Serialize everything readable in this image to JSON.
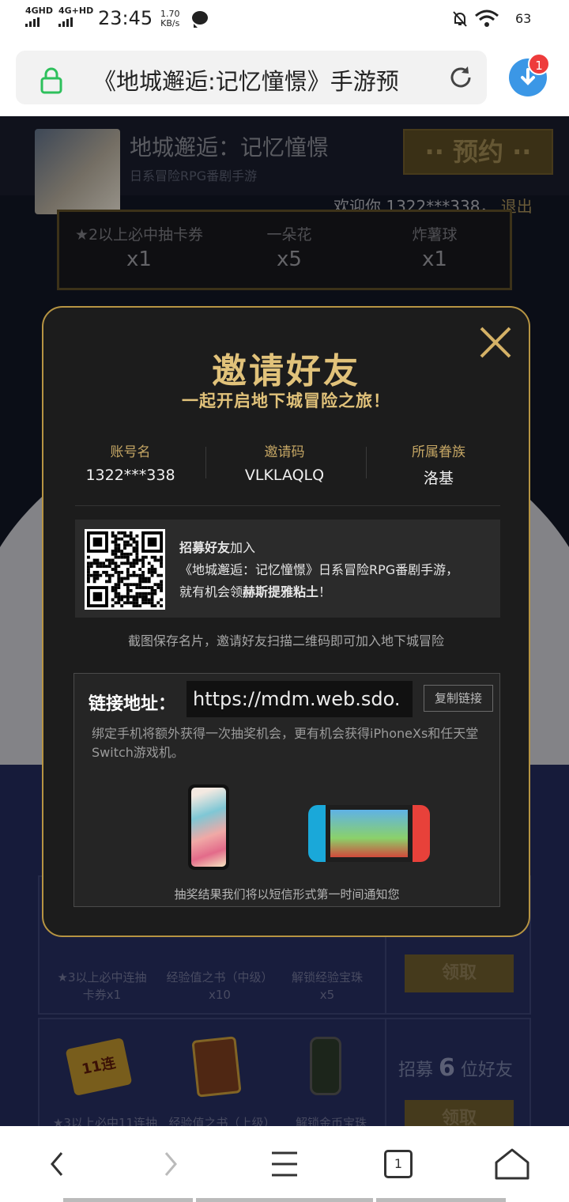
{
  "status_bar": {
    "sim1": "4GHD",
    "sim2": "4G+HD",
    "time": "23:45",
    "speed_value": "1.70",
    "speed_unit": "KB/s",
    "battery": "63"
  },
  "browser": {
    "url_title": "《地城邂逅:记忆憧憬》手游预",
    "download_badge": "1"
  },
  "page": {
    "game_name": "地城邂逅：记忆憧憬",
    "game_subtitle": "日系冒险RPG番剧手游",
    "reserve_label": "·· 预约 ··",
    "welcome_prefix": "欢迎你",
    "welcome_user": "1322***338，",
    "logout_label": "退出",
    "rewards": [
      {
        "name": "★2以上必中抽卡券",
        "qty": "x1"
      },
      {
        "name": "一朵花",
        "qty": "x5"
      },
      {
        "name": "炸薯球",
        "qty": "x1"
      }
    ],
    "task1": {
      "items": [
        {
          "name": "★3以上必中连抽卡券x1",
          "line1": "★3以上必中连抽",
          "line2": "卡券x1"
        },
        {
          "name": "经验值之书（中级）",
          "line1": "经验值之书（中级）",
          "line2": "x10"
        },
        {
          "name": "解锁经验宝珠",
          "line1": "解锁经验宝珠",
          "line2": "x5"
        }
      ],
      "claim_label": "领取"
    },
    "task2": {
      "items": [
        {
          "name": "★3以上必中11连抽",
          "icon_text": "11连"
        },
        {
          "name": "经验值之书（上级）"
        },
        {
          "name": "解锁金币宝珠"
        }
      ],
      "recruit_prefix": "招募",
      "recruit_count": "6",
      "recruit_suffix": "位好友",
      "claim_label": "领取"
    }
  },
  "modal": {
    "title": "邀请好友",
    "subtitle": "一起开启地下城冒险之旅！",
    "account_label": "账号名",
    "account_value": "1322***338",
    "invite_label": "邀请码",
    "invite_value": "VLKLAQLQ",
    "family_label": "所属眷族",
    "family_value": "洛基",
    "qr_line1_bold": "招募好友",
    "qr_line1_rest": "加入",
    "qr_line2": "《地城邂逅：记忆憧憬》日系冒险RPG番剧手游，",
    "qr_line3_prefix": "就有机会领",
    "qr_line3_bold": "赫斯提雅粘土",
    "qr_line3_suffix": "！",
    "tip": "截图保存名片，邀请好友扫描二维码即可加入地下城冒险",
    "link_label": "链接地址：",
    "link_value": "https://mdm.web.sdo.",
    "copy_label": "复制链接",
    "bind_text": "绑定手机将额外获得一次抽奖机会，更有机会获得iPhoneXs和任天堂Switch游戏机。",
    "notify": "抽奖结果我们将以短信形式第一时间通知您"
  },
  "bottom_nav": {
    "tab_count": "1"
  },
  "colors": {
    "gold": "#e1c27a",
    "modal_bg": "#1c1c1c",
    "navy": "#232a59",
    "download_blue": "#3b97e6",
    "badge_red": "#ee3c3c"
  }
}
